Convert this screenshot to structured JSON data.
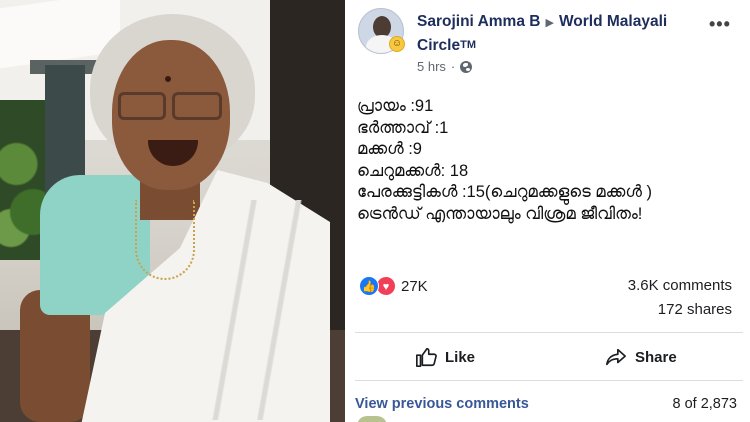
{
  "post": {
    "author": "Sarojini Amma B",
    "group": "World Malayali Circle",
    "group_tm": "TM",
    "timestamp": "5 hrs",
    "body_lines": [
      "പ്രായം :91",
      "ഭർത്താവ് :1",
      "മക്കൾ :9",
      "ചെറുമക്കൾ: 18",
      "പേരക്കുട്ടികൾ :15(ചെറുമക്കളുടെ മക്കൾ )",
      "ട്രെൻഡ് എന്തായാലും വിശ്രമ ജീവിതം!"
    ],
    "reactions": {
      "count": "27K",
      "types": [
        "like-icon",
        "love-icon"
      ]
    },
    "comments_count": "3.6K comments",
    "shares_count": "172 shares"
  },
  "actions": {
    "like_label": "Like",
    "share_label": "Share"
  },
  "comments": {
    "view_previous_label": "View previous comments",
    "pagination": "8 of 2,873"
  },
  "colors": {
    "facebook_blue": "#1877f2",
    "link_blue": "#385898",
    "love_red": "#f33e58",
    "header_navy": "#1d2d5c"
  }
}
